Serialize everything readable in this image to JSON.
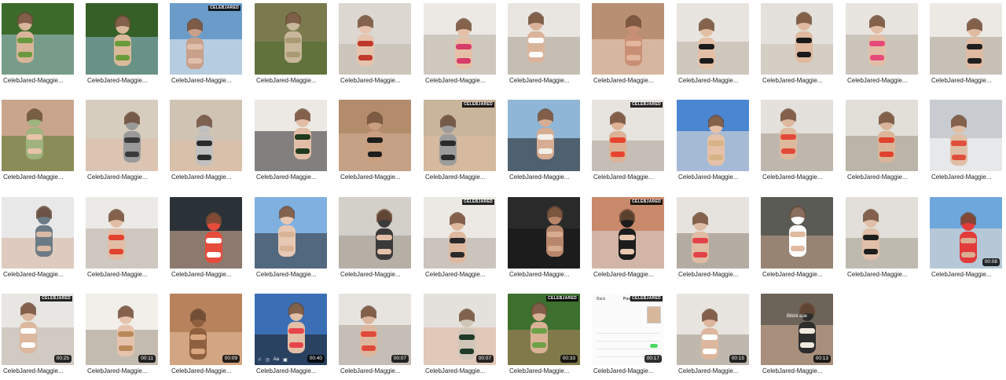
{
  "item_name": "CelebJared-Maggie...",
  "watermark": "CELEBJARED",
  "items": [
    {
      "duration": ""
    },
    {
      "duration": ""
    },
    {
      "duration": ""
    },
    {
      "duration": ""
    },
    {
      "duration": ""
    },
    {
      "duration": ""
    },
    {
      "duration": ""
    },
    {
      "duration": ""
    },
    {
      "duration": ""
    },
    {
      "duration": ""
    },
    {
      "duration": ""
    },
    {
      "duration": ""
    },
    {
      "duration": ""
    },
    {
      "duration": ""
    },
    {
      "duration": ""
    },
    {
      "duration": ""
    },
    {
      "duration": ""
    },
    {
      "duration": ""
    },
    {
      "duration": ""
    },
    {
      "duration": ""
    },
    {
      "duration": ""
    },
    {
      "duration": ""
    },
    {
      "duration": ""
    },
    {
      "duration": ""
    },
    {
      "duration": ""
    },
    {
      "duration": ""
    },
    {
      "duration": ""
    },
    {
      "duration": ""
    },
    {
      "duration": ""
    },
    {
      "duration": ""
    },
    {
      "duration": ""
    },
    {
      "duration": ""
    },
    {
      "duration": ""
    },
    {
      "duration": ""
    },
    {
      "duration": ""
    },
    {
      "duration": "00:08"
    },
    {
      "duration": "00:25"
    },
    {
      "duration": "00:11"
    },
    {
      "duration": "00:09"
    },
    {
      "duration": "00:40"
    },
    {
      "duration": "00:07"
    },
    {
      "duration": "00:07"
    },
    {
      "duration": "00:33"
    },
    {
      "duration": "00:17"
    },
    {
      "duration": "00:15"
    },
    {
      "duration": "00:13"
    }
  ],
  "overlay_texts": {
    "post_back": "Back",
    "post_title": "Post",
    "post_cancel": "Cancel",
    "story_text": "Bikini ape"
  },
  "colors": {
    "caption": "#222222",
    "badge_bg": "#000000",
    "background": "#ffffff"
  }
}
